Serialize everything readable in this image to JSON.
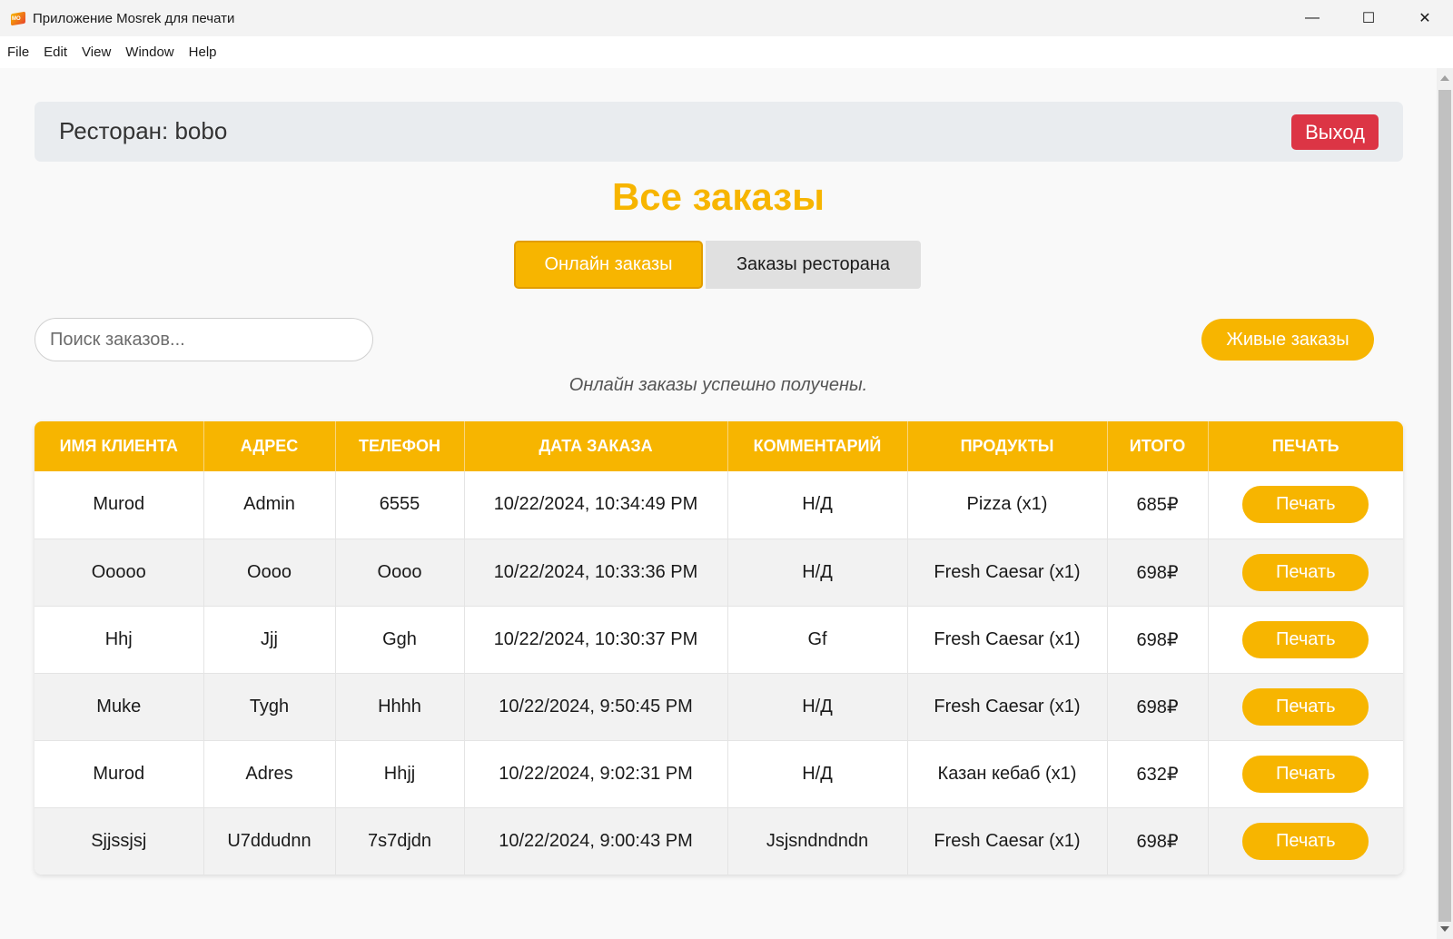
{
  "window": {
    "title": "Приложение Mosrek для печати",
    "controls": {
      "minimize": "—",
      "maximize": "☐",
      "close": "✕"
    }
  },
  "menu": [
    "File",
    "Edit",
    "View",
    "Window",
    "Help"
  ],
  "header": {
    "restaurant_label": "Ресторан: bobo",
    "logout_label": "Выход"
  },
  "page_title": "Все заказы",
  "tabs": [
    {
      "label": "Онлайн заказы",
      "active": true
    },
    {
      "label": "Заказы ресторана",
      "active": false
    }
  ],
  "search": {
    "placeholder": "Поиск заказов...",
    "value": ""
  },
  "live_orders_label": "Живые заказы",
  "status_message": "Онлайн заказы успешно получены.",
  "colors": {
    "accent": "#f7b500",
    "danger": "#dc3545"
  },
  "table": {
    "headers": [
      "Имя клиента",
      "Адрес",
      "Телефон",
      "Дата заказа",
      "Комментарий",
      "Продукты",
      "Итого",
      "Печать"
    ],
    "print_label": "Печать",
    "rows": [
      {
        "name": "Murod",
        "address": "Admin",
        "phone": "6555",
        "date": "10/22/2024, 10:34:49 PM",
        "comment": "Н/Д",
        "products": "Pizza (x1)",
        "total": "685₽"
      },
      {
        "name": "Ooooo",
        "address": "Oooo",
        "phone": "Oooo",
        "date": "10/22/2024, 10:33:36 PM",
        "comment": "Н/Д",
        "products": "Fresh Caesar (x1)",
        "total": "698₽"
      },
      {
        "name": "Hhj",
        "address": "Jjj",
        "phone": "Ggh",
        "date": "10/22/2024, 10:30:37 PM",
        "comment": "Gf",
        "products": "Fresh Caesar (x1)",
        "total": "698₽"
      },
      {
        "name": "Muke",
        "address": "Tygh",
        "phone": "Hhhh",
        "date": "10/22/2024, 9:50:45 PM",
        "comment": "Н/Д",
        "products": "Fresh Caesar (x1)",
        "total": "698₽"
      },
      {
        "name": "Murod",
        "address": "Adres",
        "phone": "Hhjj",
        "date": "10/22/2024, 9:02:31 PM",
        "comment": "Н/Д",
        "products": "Казан кебаб (x1)",
        "total": "632₽"
      },
      {
        "name": "Sjjssjsj",
        "address": "U7ddudnn",
        "phone": "7s7djdn",
        "date": "10/22/2024, 9:00:43 PM",
        "comment": "Jsjsndndndn",
        "products": "Fresh Caesar (x1)",
        "total": "698₽"
      }
    ]
  }
}
